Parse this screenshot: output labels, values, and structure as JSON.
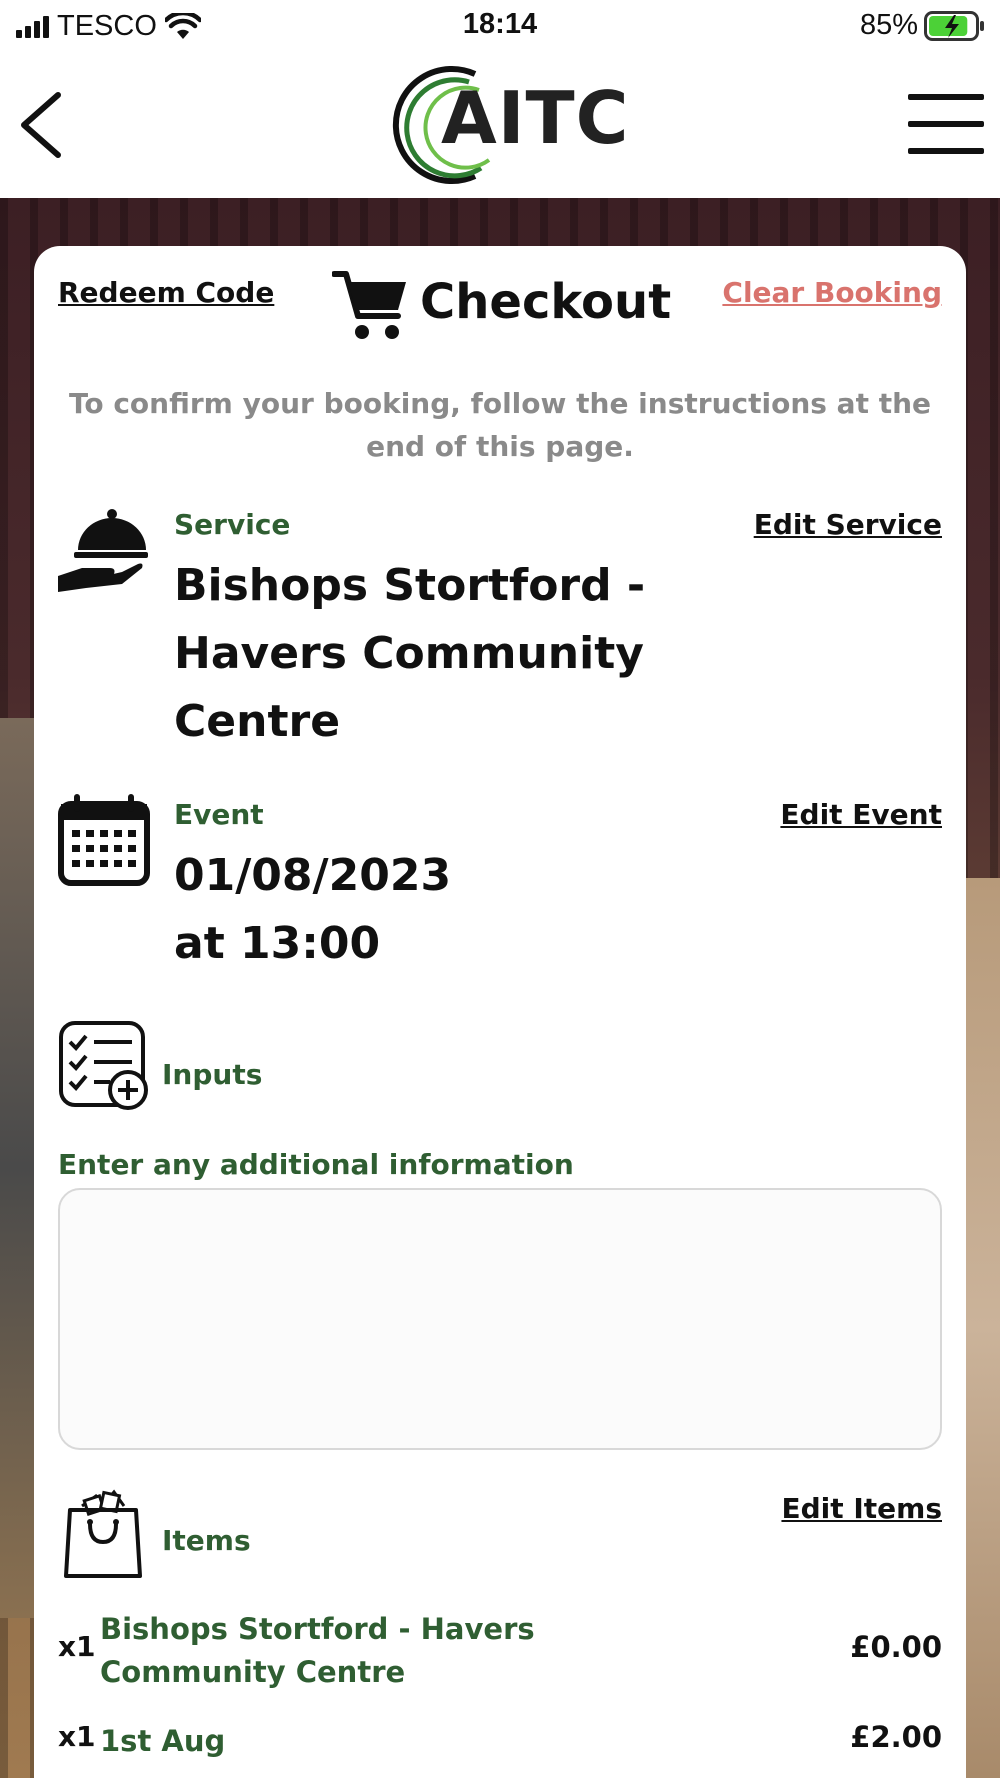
{
  "status_bar": {
    "carrier": "TESCO",
    "time": "18:14",
    "battery_percent": "85%",
    "battery_level": 0.85
  },
  "header": {
    "logo_text": "AITC",
    "back_icon": "chevron-left-icon",
    "menu_icon": "hamburger-menu-icon"
  },
  "checkout": {
    "redeem_label": "Redeem Code",
    "title": "Checkout",
    "clear_label": "Clear Booking",
    "instructions": "To confirm your booking, follow the instructions at the end of this page."
  },
  "service": {
    "label": "Service",
    "edit_label": "Edit Service",
    "value_lines": [
      "Bishops Stortford -",
      "Havers Community",
      "Centre"
    ]
  },
  "event": {
    "label": "Event",
    "edit_label": "Edit Event",
    "date": "01/08/2023",
    "time": "at 13:00"
  },
  "inputs": {
    "label": "Inputs",
    "field_label": "Enter any additional information",
    "field_value": ""
  },
  "items": {
    "label": "Items",
    "edit_label": "Edit Items",
    "rows": [
      {
        "qty": "x1",
        "name": "Bishops Stortford -  Havers Community Centre",
        "price": "£0.00"
      },
      {
        "qty": "x1",
        "name": "1st Aug",
        "price": "£2.00"
      }
    ]
  },
  "colors": {
    "accent_green": "#2f5e32",
    "clear_red": "#d9736d",
    "battery_green": "#4cd137"
  }
}
